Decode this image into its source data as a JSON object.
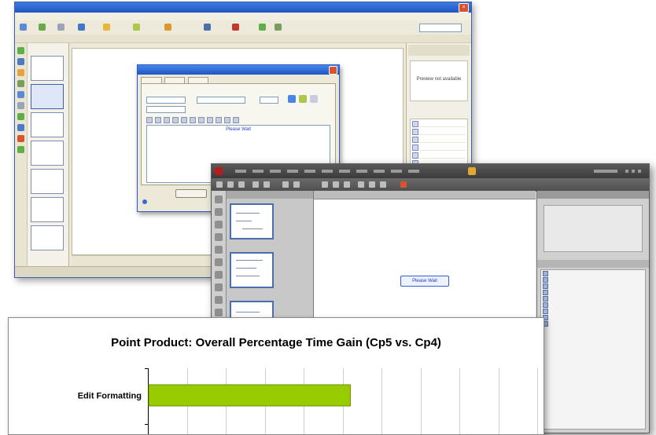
{
  "back_window": {
    "title": "",
    "dialog": {
      "caption_text": "Please Wait"
    },
    "panel_preview_text": "Preview not available"
  },
  "front_window": {
    "caption_text": "Please Wait",
    "colors": {
      "chrome": "#3b3b3b",
      "stage": "#ffffff"
    }
  },
  "chart_data": {
    "type": "bar",
    "orientation": "horizontal",
    "title": "Point Product: Overall Percentage Time Gain (Cp5 vs. Cp4)",
    "categories": [
      "Edit Formatting"
    ],
    "values": [
      52
    ],
    "xlim": [
      0,
      100
    ],
    "x_gridlines": 10,
    "grid": true,
    "bar_color": "#99cc00",
    "bar_border": "#6a8f00"
  }
}
